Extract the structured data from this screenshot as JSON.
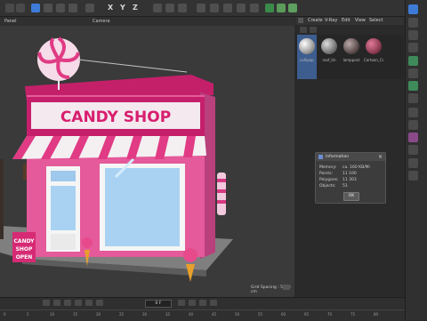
{
  "toolbar": {
    "letters": [
      "X",
      "Y",
      "Z"
    ]
  },
  "viewport": {
    "panel_label": "Panel",
    "camera_label": "Camera",
    "grid_spacing": "Grid Spacing : 5000 cm",
    "sign_text": "CANDY SHOP",
    "board_lines": [
      "CANDY",
      "SHOP",
      "OPEN"
    ]
  },
  "material_panel": {
    "menu": [
      "Create",
      "V-Ray",
      "Edit",
      "View",
      "Select"
    ],
    "materials": [
      {
        "label": "Lollipop",
        "color": "#c8c8c8"
      },
      {
        "label": "roof_tin",
        "color": "#8a8a8a"
      },
      {
        "label": "lamppost",
        "color": "#5e4e4e"
      },
      {
        "label": "Cartoon_Ca",
        "color": "#8e3c52"
      }
    ]
  },
  "info_dialog": {
    "title": "Information",
    "rows": [
      {
        "label": "Memory:",
        "value": "ca. 160 KB/Mi"
      },
      {
        "label": "Points:",
        "value": "11 100"
      },
      {
        "label": "Polygons:",
        "value": "11 303"
      },
      {
        "label": "Objects:",
        "value": "51"
      }
    ],
    "ok_label": "OK"
  },
  "timeline": {
    "frame_field": "0 F",
    "ticks": [
      "0",
      "5",
      "10",
      "15",
      "20",
      "25",
      "30",
      "35",
      "40",
      "45",
      "50",
      "55",
      "60",
      "65",
      "70",
      "75",
      "80"
    ]
  },
  "colors": {
    "accent": "#3d7bd6",
    "shop_pink": "#e55a9a",
    "roof_magenta": "#c4206a",
    "sign_text": "#d81e6e"
  }
}
